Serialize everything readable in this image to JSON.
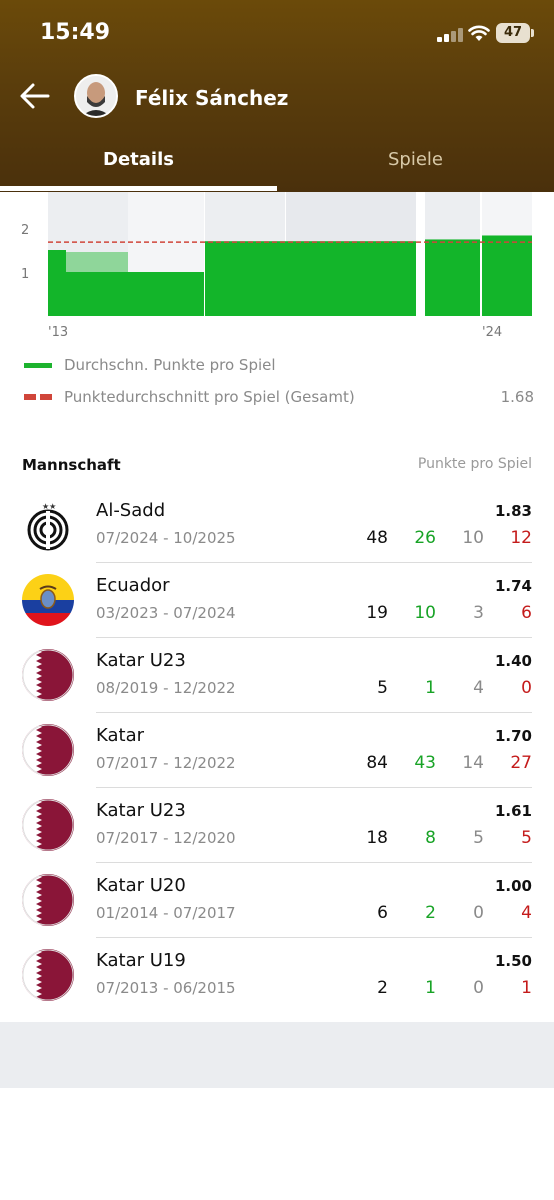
{
  "status_bar": {
    "time": "15:49",
    "battery": "47"
  },
  "header": {
    "coach_name": "Félix Sánchez"
  },
  "tabs": [
    {
      "label": "Details",
      "active": true
    },
    {
      "label": "Spiele",
      "active": false
    }
  ],
  "chart_data": {
    "type": "bar",
    "y_ticks": [
      "1",
      "2"
    ],
    "x_ticks": [
      "'13",
      "'24"
    ],
    "ylim": [
      0,
      2.3
    ],
    "average_line": 1.68,
    "legend": [
      {
        "label": "Durchschn. Punkte pro Spiel",
        "color": "#1db32e"
      },
      {
        "label": "Punktedurchschnitt pro Spiel (Gesamt)",
        "color": "#d0453a",
        "value": "1.68"
      }
    ],
    "series": [
      {
        "period": "07/2013 - 06/2015",
        "ppg": 1.5
      },
      {
        "period": "01/2014 - 07/2017",
        "ppg": 1.0
      },
      {
        "period": "07/2017 - 12/2020",
        "ppg": 1.61
      },
      {
        "period": "08/2019 - 12/2022",
        "ppg": 1.4
      },
      {
        "period": "07/2017 - 12/2022",
        "ppg": 1.7
      },
      {
        "period": "03/2023 - 07/2024",
        "ppg": 1.74
      },
      {
        "period": "07/2024 - 10/2025",
        "ppg": 1.83
      }
    ]
  },
  "section": {
    "title": "Mannschaft",
    "subtitle": "Punkte pro Spiel"
  },
  "teams": [
    {
      "name": "Al-Sadd",
      "period": "07/2024 - 10/2025",
      "ppg": "1.83",
      "games": "48",
      "wins": "26",
      "draws": "10",
      "losses": "12",
      "logo": "al-sadd-logo"
    },
    {
      "name": "Ecuador",
      "period": "03/2023 - 07/2024",
      "ppg": "1.74",
      "games": "19",
      "wins": "10",
      "draws": "3",
      "losses": "6",
      "logo": "ecuador-flag"
    },
    {
      "name": "Katar U23",
      "period": "08/2019 - 12/2022",
      "ppg": "1.40",
      "games": "5",
      "wins": "1",
      "draws": "4",
      "losses": "0",
      "logo": "qatar-flag"
    },
    {
      "name": "Katar",
      "period": "07/2017 - 12/2022",
      "ppg": "1.70",
      "games": "84",
      "wins": "43",
      "draws": "14",
      "losses": "27",
      "logo": "qatar-flag"
    },
    {
      "name": "Katar U23",
      "period": "07/2017 - 12/2020",
      "ppg": "1.61",
      "games": "18",
      "wins": "8",
      "draws": "5",
      "losses": "5",
      "logo": "qatar-flag"
    },
    {
      "name": "Katar U20",
      "period": "01/2014 - 07/2017",
      "ppg": "1.00",
      "games": "6",
      "wins": "2",
      "draws": "0",
      "losses": "4",
      "logo": "qatar-flag"
    },
    {
      "name": "Katar U19",
      "period": "07/2013 - 06/2015",
      "ppg": "1.50",
      "games": "2",
      "wins": "1",
      "draws": "0",
      "losses": "1",
      "logo": "qatar-flag"
    }
  ]
}
